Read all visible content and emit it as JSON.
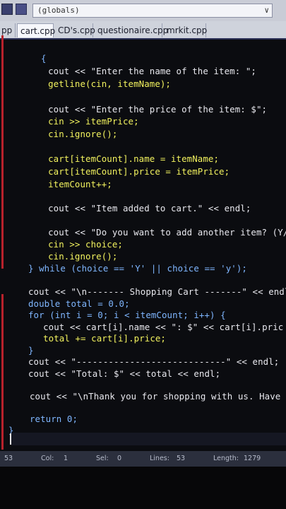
{
  "scope_selector": {
    "value": "(globals)",
    "arrow": "∨"
  },
  "tabs": [
    {
      "label": "pp"
    },
    {
      "label": "cart.cpp"
    },
    {
      "label": "CD's.cpp"
    },
    {
      "label": "questionaire.cpp"
    },
    {
      "label": "mrkit.cpp"
    }
  ],
  "code": [
    {
      "text": "{"
    },
    {
      "text": "  cout << \"Enter the name of the item: \";"
    },
    {
      "text": "  getline(cin, itemName);"
    },
    {
      "text": ""
    },
    {
      "text": "  cout << \"Enter the price of the item: $\";"
    },
    {
      "text": "  cin >> itemPrice;"
    },
    {
      "text": "  cin.ignore();"
    },
    {
      "text": ""
    },
    {
      "text": "  cart[itemCount].name = itemName;"
    },
    {
      "text": "  cart[itemCount].price = itemPrice;"
    },
    {
      "text": "  itemCount++;"
    },
    {
      "text": ""
    },
    {
      "text": "  cout << \"Item added to cart.\" << endl;"
    },
    {
      "text": ""
    },
    {
      "text": "  cout << \"Do you want to add another item? (Y/"
    },
    {
      "text": "  cin >> choice;"
    },
    {
      "text": "  cin.ignore();"
    },
    {
      "text": "} while (choice == 'Y' || choice == 'y');"
    },
    {
      "text": ""
    },
    {
      "text": "cout << \"\\n------- Shopping Cart -------\" << endl"
    },
    {
      "text": "double total = 0.0;"
    },
    {
      "text": "for (int i = 0; i < itemCount; i++) {"
    },
    {
      "text": "  cout << cart[i].name << \": $\" << cart[i].pric"
    },
    {
      "text": "  total += cart[i].price;"
    },
    {
      "text": "}"
    },
    {
      "text": "cout << \"----------------------------\" << endl;"
    },
    {
      "text": "cout << \"Total: $\" << total << endl;"
    },
    {
      "text": ""
    },
    {
      "text": "cout << \"\\nThank you for shopping with us. Have a"
    },
    {
      "text": ""
    },
    {
      "text": "return 0;"
    },
    {
      "text": "}"
    }
  ],
  "status": {
    "line": "53",
    "col_label": "Col:",
    "col": "1",
    "sel_label": "Sel:",
    "sel": "0",
    "lines_label": "Lines:",
    "lines": "53",
    "length_label": "Length:",
    "length": "1279"
  }
}
